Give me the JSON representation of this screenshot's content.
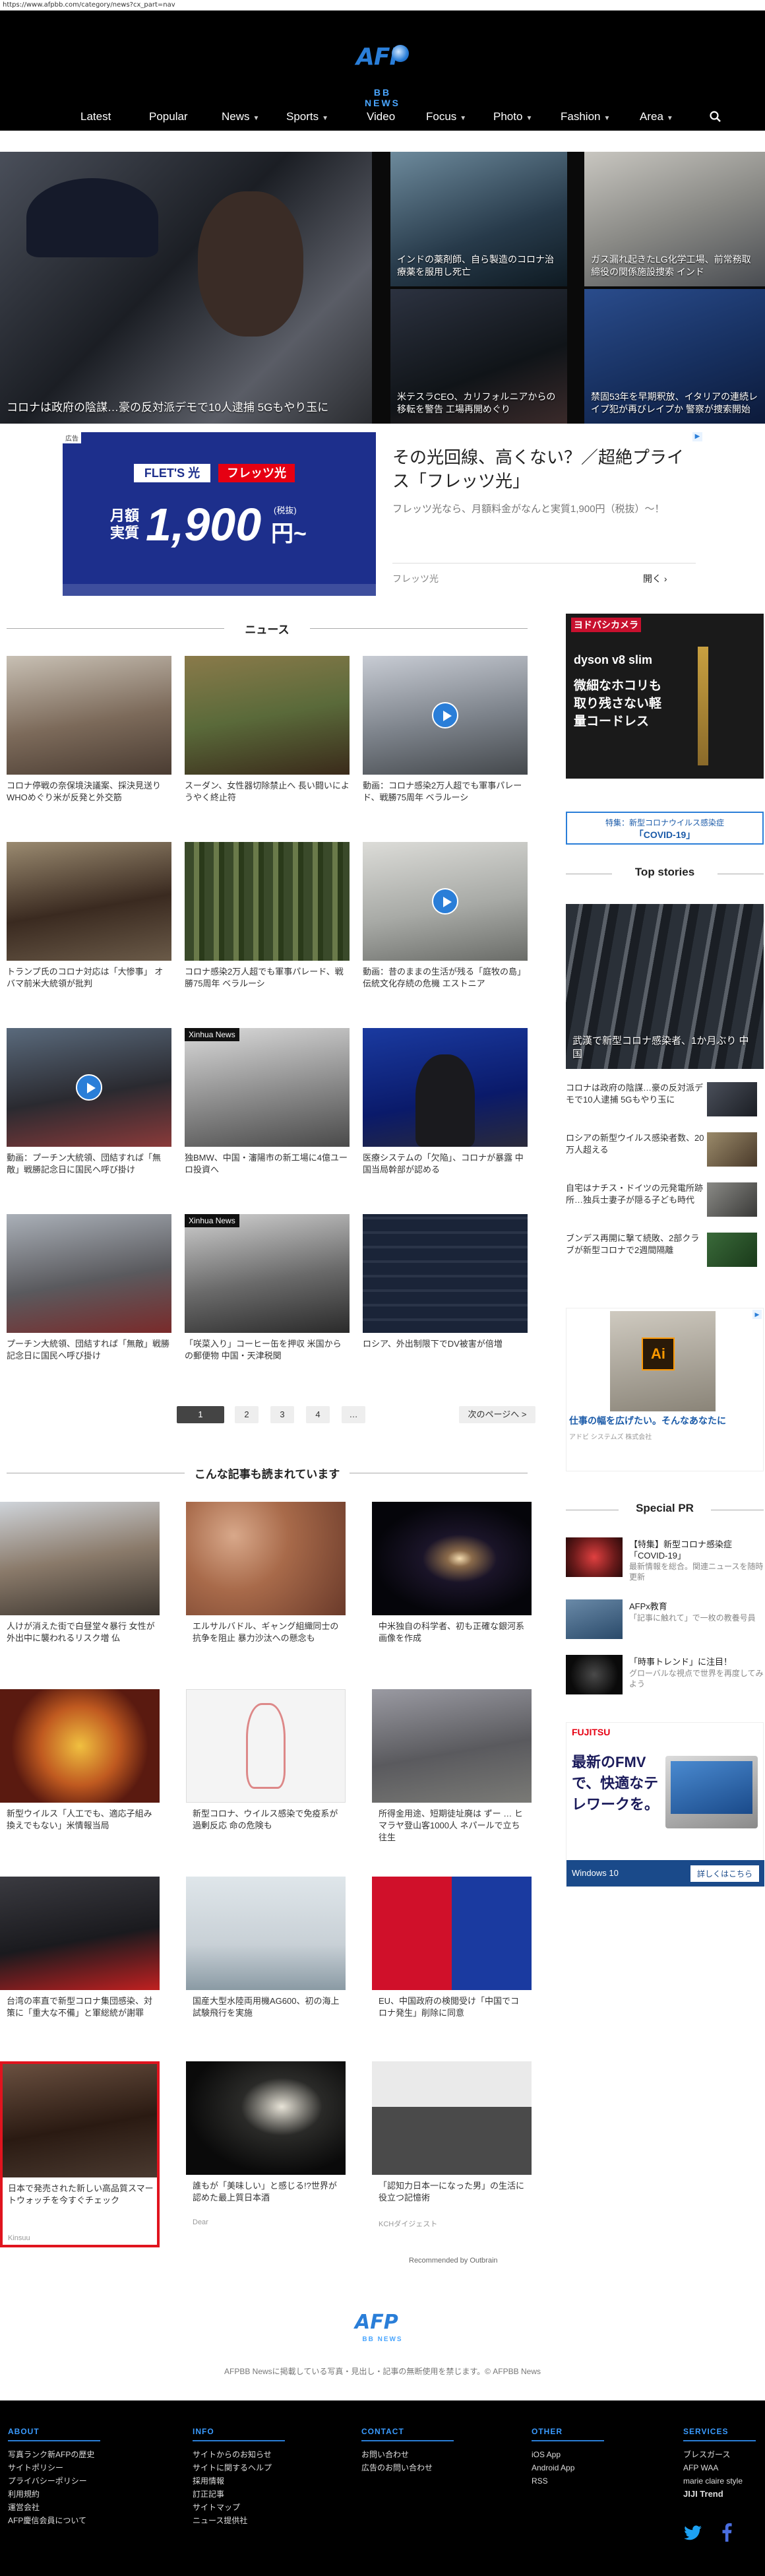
{
  "url": "https://www.afpbb.com/category/news?cx_part=nav",
  "logo": {
    "brand": "AFP",
    "sub": "BB NEWS"
  },
  "nav": [
    "Latest",
    "Popular",
    "News",
    "Sports",
    "Video",
    "Focus",
    "Photo",
    "Fashion",
    "Area"
  ],
  "hero": {
    "main": "コロナは政府の陰謀…豪の反対派デモで10人逮捕 5Gもやり玉に",
    "tiles": [
      "インドの薬剤師、自ら製造のコロナ治療薬を服用し死亡",
      "ガス漏れ起きたLG化学工場、前常務取締役の関係施設捜索 インド",
      "米テスラCEO、カリフォルニアからの移転を警告 工場再開めぐり",
      "禁固53年を早期釈放、イタリアの連続レイプ犯が再びレイプか 警察が捜索開始"
    ]
  },
  "ad1": {
    "label": "広告",
    "brand1": "FLET'S 光",
    "brand2": "フレッツ光",
    "monthly": "月額",
    "actual": "実質",
    "price": "1,900",
    "unit": "円~",
    "tax": "(税抜)",
    "headline": "その光回線、高くない？／超絶プライス「フレッツ光」",
    "body": "フレッツ光なら、月額料金がなんと実質1,900円（税抜）～！",
    "advertiser": "フレッツ光",
    "cta": "開く ›"
  },
  "news_heading": "ニュース",
  "news": [
    {
      "text": "コロナ停戦の奈保境決議案、採決見送り WHOめぐり米が反発と外交筋",
      "tag": ""
    },
    {
      "text": "スーダン、女性器切除禁止へ 長い闘いにようやく終止符",
      "tag": ""
    },
    {
      "text": "動画：コロナ感染2万人超でも軍事パレード、戦勝75周年 ベラルーシ",
      "tag": ""
    },
    {
      "text": "トランプ氏のコロナ対応は「大惨事」 オバマ前米大統領が批判",
      "tag": ""
    },
    {
      "text": "コロナ感染2万人超でも軍事パレード、戦勝75周年 ベラルーシ",
      "tag": ""
    },
    {
      "text": "動画：昔のままの生活が残る「庭牧の島」伝統文化存続の危機 エストニア",
      "tag": ""
    },
    {
      "text": "動画：プーチン大統領、団結すれば「無敵」戦勝記念日に国民へ呼び掛け",
      "tag": ""
    },
    {
      "text": "独BMW、中国・瀋陽市の新工場に4億ユーロ投資へ",
      "tag": "Xinhua News"
    },
    {
      "text": "医療システムの「欠陥」、コロナが暴露 中国当局幹部が認める",
      "tag": ""
    },
    {
      "text": "プーチン大統領、団結すれば「無敵」戦勝記念日に国民へ呼び掛け",
      "tag": ""
    },
    {
      "text": "「咲菜入り」コーヒー缶を押収 米国からの郵便物 中国・天津税関",
      "tag": "Xinhua News"
    },
    {
      "text": "ロシア、外出制限下でDV被害が倍増",
      "tag": ""
    }
  ],
  "pager": {
    "pages": [
      "1",
      "2",
      "3",
      "4",
      "…"
    ],
    "next": "次のページへ >"
  },
  "also_heading": "こんな記事も読まれています",
  "also": [
    {
      "text": "人けが消えた街で白昼堂々暴行 女性が外出中に襲われるリスク増 仏",
      "src": ""
    },
    {
      "text": "エルサルバドル、ギャング組織同士の抗争を阻止 暴力沙汰への懸念も",
      "src": ""
    },
    {
      "text": "中米独自の科学者、初も正確な銀河系画像を作成",
      "src": ""
    },
    {
      "text": "新型ウイルス「人工でも、適応子組み換えでもない」米情報当局",
      "src": ""
    },
    {
      "text": "新型コロナ、ウイルス感染で免疫系が過剰反応 命の危険も",
      "src": ""
    },
    {
      "text": "所得金用途、短期徒址廃は ずー … ヒマラヤ登山客1000人 ネパールで立ち往生",
      "src": ""
    },
    {
      "text": "台湾の率直で新型コロナ集団感染、対策に「重大な不備」と軍総統が謝罪",
      "src": ""
    },
    {
      "text": "国産大型水陸両用機AG600、初の海上試験飛行を実施",
      "src": ""
    },
    {
      "text": "EU、中国政府の検閲受け「中国でコロナ発生」削除に同意",
      "src": ""
    },
    {
      "text": "日本で発売された新しい高品質スマートウォッチを今すぐチェック",
      "src": "Kinsuu"
    },
    {
      "text": "誰もが「美味しい」と感じる!?世界が認めた最上質日本酒",
      "src": "Dear"
    },
    {
      "text": "「認知力日本一になった男」の生活に役立つ記憶術",
      "src": "KCHダイジェスト"
    }
  ],
  "recommended": "Recommended by Outbrain",
  "footer_note": "AFPBB Newsに掲載している写真・見出し・記事の無断使用を禁じます。© AFPBB News",
  "side": {
    "ad_brand": "ヨドバシカメラ",
    "ad_product": "dyson v8 slim",
    "ad_copy": "微細なホコリも取り残さない軽量コードレス",
    "special_label": "特集：新型コロナウイルス感染症",
    "special_covid": "「COVID-19」",
    "top_stories_heading": "Top stories",
    "top_main": "武漢で新型コロナ感染者、1か月ぶり 中国",
    "top_list": [
      "コロナは政府の陰謀…豪の反対派デモで10人逮捕 5Gもやり玉に",
      "ロシアの新型ウイルス感染者数、20万人超える",
      "自宅はナチス・ドイツの元発電所跡所…独兵士妻子が隠る子ども時代",
      "ブンデス再開に撃て続敗、2部クラブが新型コロナで2週間隔離"
    ],
    "ai_headline": "仕事の幅を広げたい。そんなあなたに",
    "ai_source": "アドビ システムズ 株式会社",
    "special_pr_heading": "Special PR",
    "pr": [
      {
        "t1": "【特集】新型コロナ感染症「COVID-19」",
        "t2": "最新情報を総合。関連ニュースを随時更新"
      },
      {
        "t1": "AFPx教育",
        "t2": "「記事に触れて」で一枚の教養号員"
      },
      {
        "t1": "「時事トレンド」に注目！",
        "t2": "グローバルな視点で世界を再度してみよう"
      }
    ],
    "fj_brand": "FUJITSU",
    "fj_copy": "最新のFMVで、快適なテレワークを。",
    "fj_win": "Windows 10",
    "fj_cta": "詳しくはこちら"
  },
  "footer": {
    "cols": [
      {
        "h": "ABOUT",
        "links": [
          "写真ランク新AFPの歴史",
          "サイトポリシー",
          "プライバシーポリシー",
          "利用規約",
          "運営会社",
          "AFP慶信会員について"
        ]
      },
      {
        "h": "INFO",
        "links": [
          "サイトからのお知らせ",
          "サイトに関するヘルプ",
          "採用情報",
          "訂正記事",
          "サイトマップ",
          "ニュース提供社"
        ]
      },
      {
        "h": "CONTACT",
        "links": [
          "お問い合わせ",
          "広告のお問い合わせ"
        ]
      },
      {
        "h": "OTHER",
        "links": [
          "iOS App",
          "Android App",
          "RSS"
        ]
      },
      {
        "h": "SERVICES",
        "links": [
          "ブレスガース",
          "AFP WAA",
          "marie claire style",
          "JIJI Trend"
        ]
      }
    ]
  },
  "colors": {
    "accent": "#2a7ed8",
    "footer_link_head": "#3a9bff",
    "header_bg": "#000000"
  }
}
